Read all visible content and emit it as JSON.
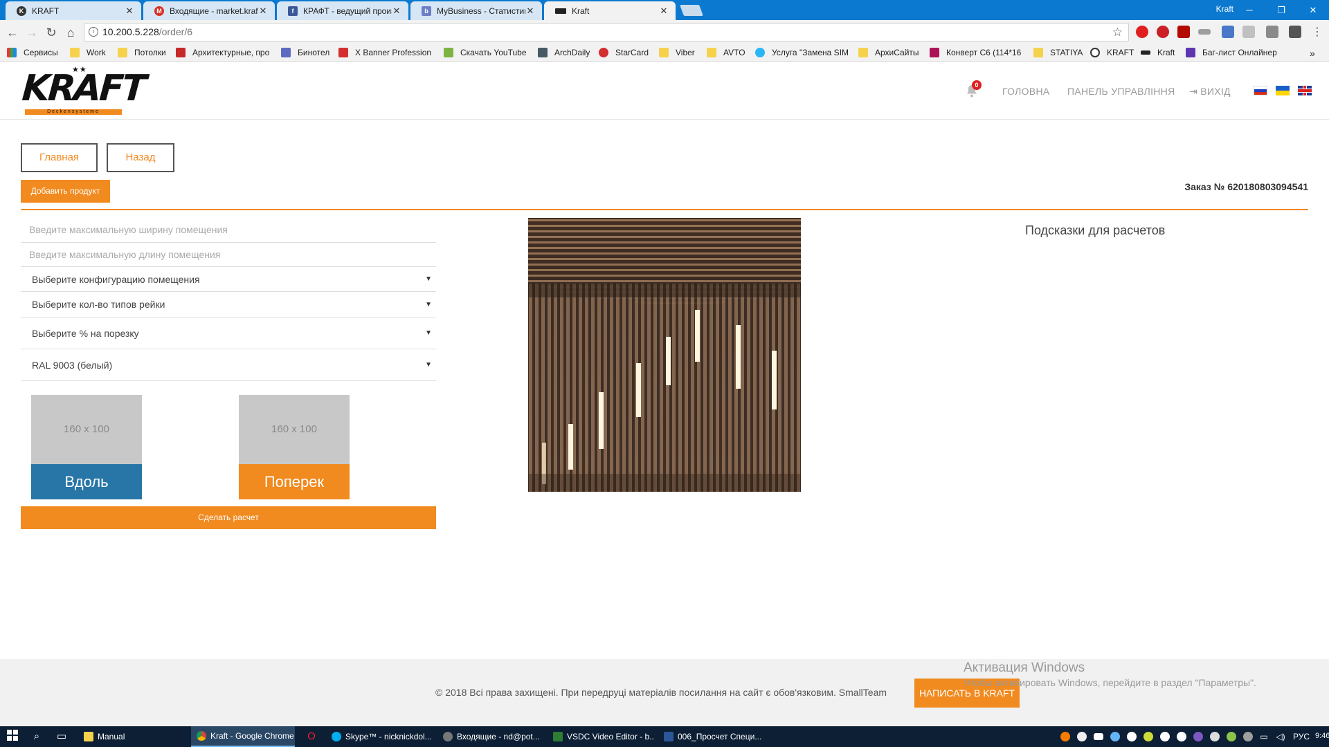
{
  "browser": {
    "tabs": [
      {
        "title": "KRAFT",
        "active": false
      },
      {
        "title": "Входящие - market.kraft",
        "active": false
      },
      {
        "title": "КРАФТ - ведущий произ",
        "active": false
      },
      {
        "title": "MyBusiness - Статистика",
        "active": false
      },
      {
        "title": "Kraft",
        "active": true
      }
    ],
    "window_user": "Kraft",
    "url_host": "10.200.5.228",
    "url_path": "/order/6",
    "bookmarks": [
      "Сервисы",
      "Work",
      "Потолки",
      "Архитектурные, про",
      "Бинотел",
      "X Banner Profession",
      "Скачать YouTube",
      "ArchDaily",
      "StarCard",
      "Viber",
      "AVTO",
      "Услуга \"Замена SIM",
      "АрхиСайты",
      "Конверт С6 (114*16",
      "STATIYA",
      "KRAFT",
      "Kraft",
      "Баг-лист Онлайнер"
    ]
  },
  "site": {
    "logo_text": "KRAFT",
    "logo_stars": "★★",
    "logo_sub": "Deckensysteme",
    "notification_count": "0",
    "nav": {
      "home": "ГОЛОВНА",
      "panel": "ПАНЕЛЬ УПРАВЛІННЯ",
      "logout": "ВИХІД"
    }
  },
  "page": {
    "btn_main": "Главная",
    "btn_back": "Назад",
    "btn_add_product": "Добавить продукт",
    "order_number": "Заказ № 620180803094541",
    "width_placeholder": "Введите максимальную ширину помещения",
    "length_placeholder": "Введите максимальную длину помещения",
    "select_config": "Выберите конфигурацию помещения",
    "select_rail_types": "Выберите кол-во типов рейки",
    "select_cut_percent": "Выберите % на порезку",
    "select_color": "RAL 9003 (белый)",
    "placeholder_size": "160 x 100",
    "btn_along": "Вдоль",
    "btn_across": "Поперек",
    "btn_calculate": "Сделать расчет",
    "hints_title": "Подсказки для расчетов"
  },
  "footer": {
    "copyright": "© 2018 Всі права захищені. При передруці матеріалів посилання на сайт є обов'язковим. SmallTeam",
    "btn_write": "НАПИСАТЬ В KRAFT",
    "activation_title": "Активация Windows",
    "activation_sub": "Чтобы активировать Windows, перейдите в раздел \"Параметры\"."
  },
  "taskbar": {
    "apps": [
      {
        "label": "Manual",
        "active": false
      },
      {
        "label": "Kraft - Google Chrome",
        "active": true
      },
      {
        "label": "Skype™ - nicknickdol...",
        "active": false
      },
      {
        "label": "Входящие - nd@pot...",
        "active": false
      },
      {
        "label": "VSDC Video Editor - b...",
        "active": false
      },
      {
        "label": "006_Просчет Специ...",
        "active": false
      }
    ],
    "lang": "РУС",
    "time": "9:46"
  },
  "colors": {
    "accent_orange": "#f18a1f",
    "along_blue": "#2876a8",
    "chrome_blue": "#0b79d0",
    "taskbar": "#0c1f35"
  }
}
